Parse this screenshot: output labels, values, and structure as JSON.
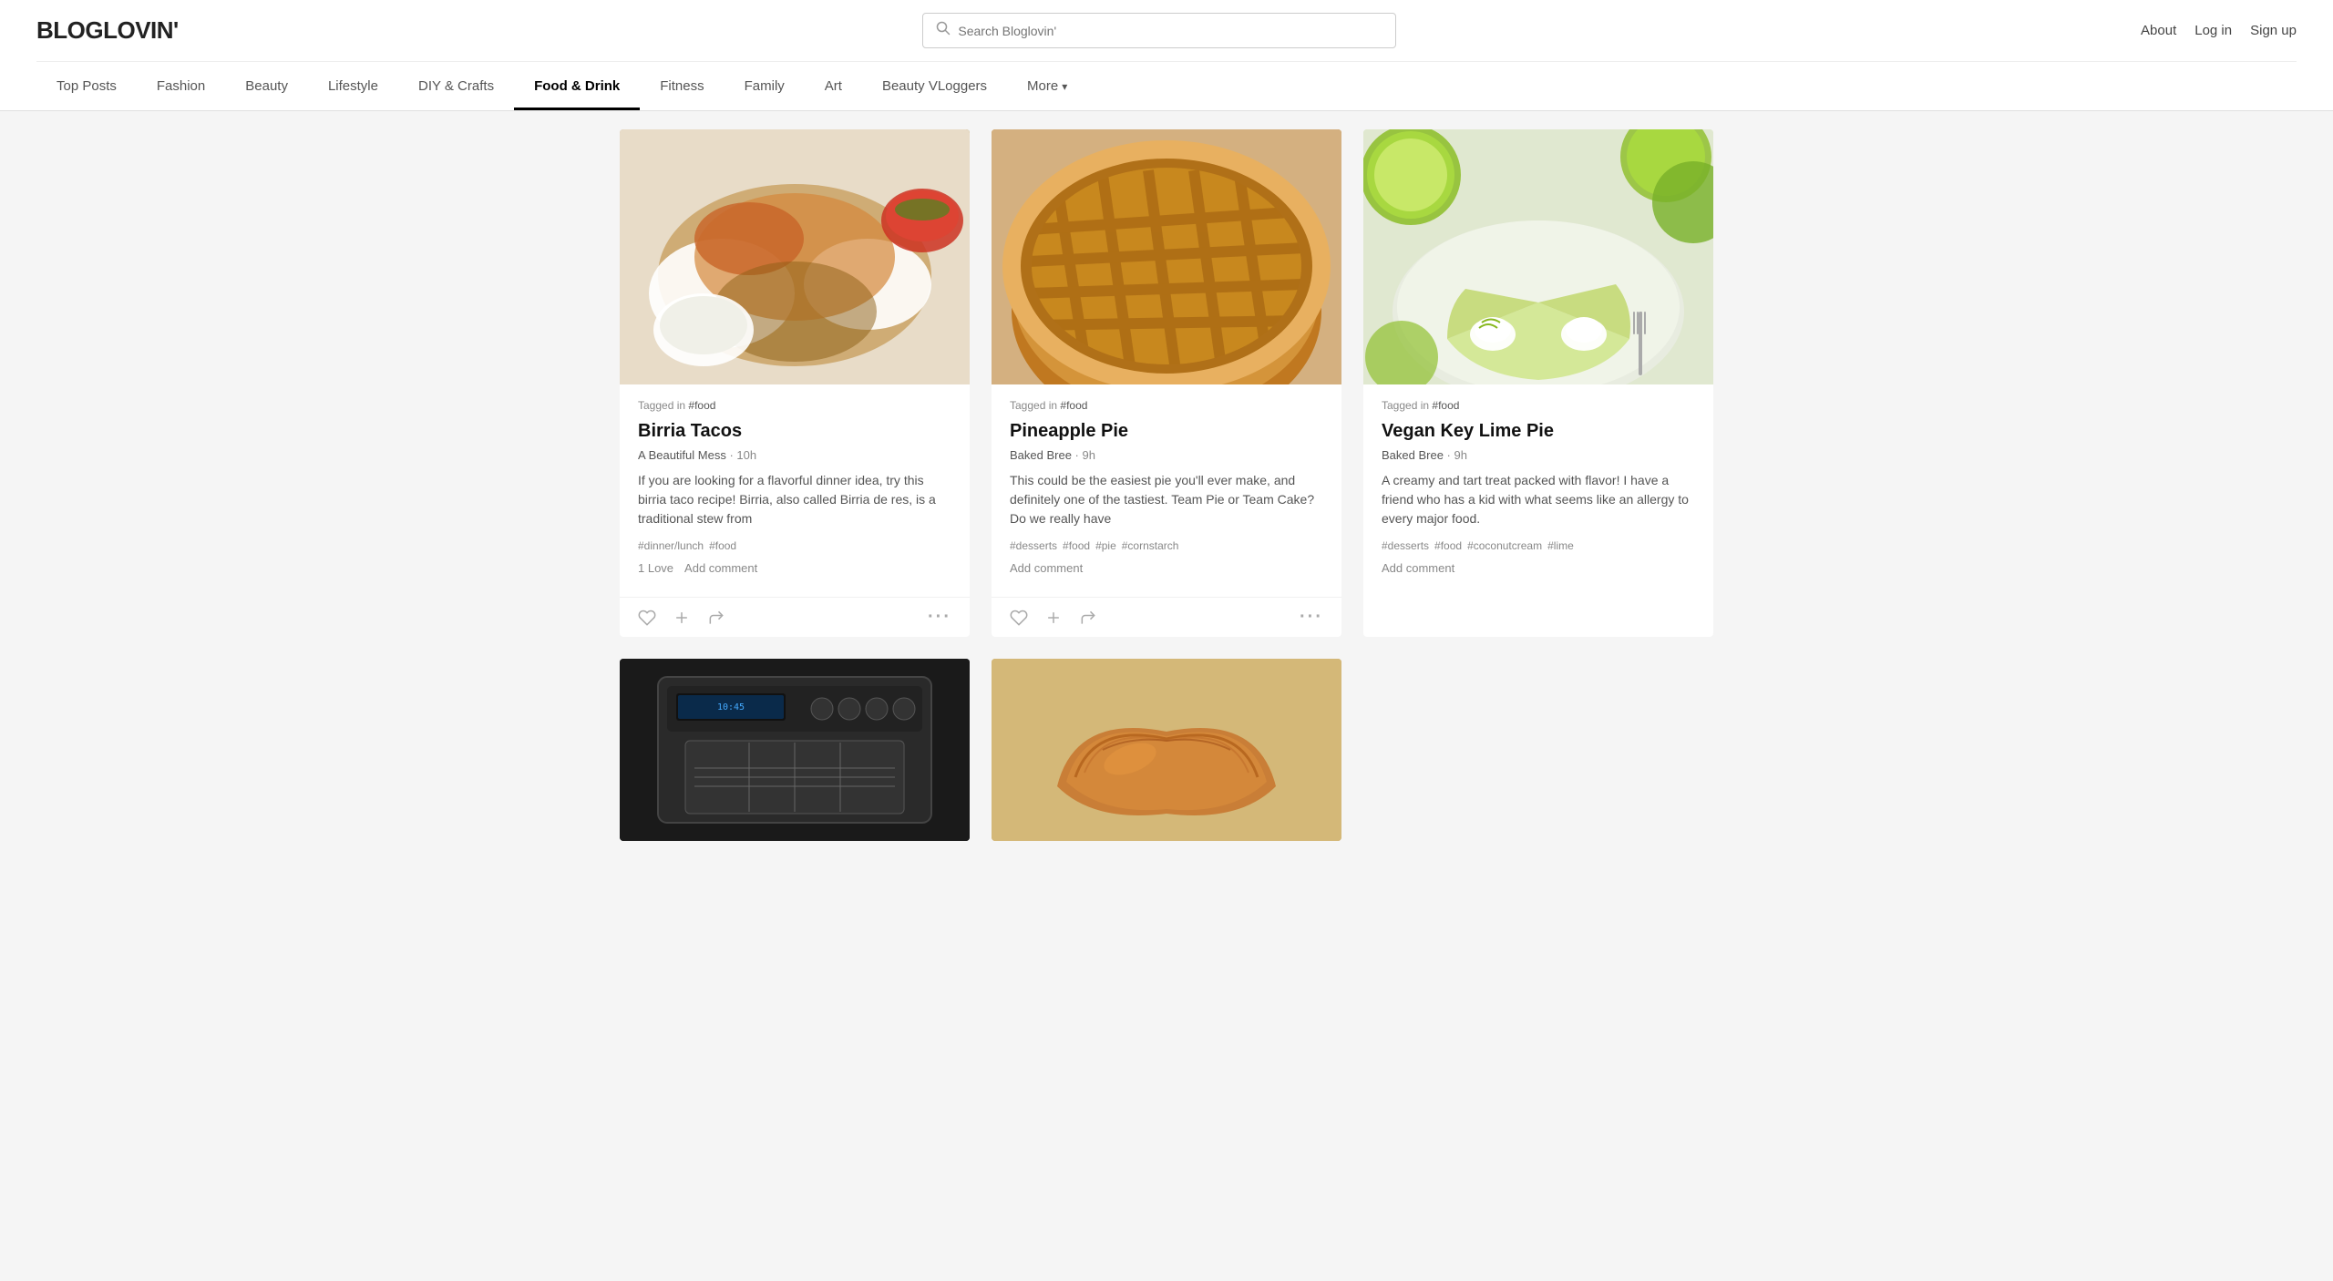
{
  "header": {
    "logo": "BLOGLOVIN'",
    "search": {
      "placeholder": "Search Bloglovin'",
      "value": ""
    },
    "links": [
      {
        "label": "About",
        "href": "#"
      },
      {
        "label": "Log in",
        "href": "#"
      },
      {
        "label": "Sign up",
        "href": "#"
      }
    ]
  },
  "nav": {
    "items": [
      {
        "label": "Top Posts",
        "active": false
      },
      {
        "label": "Fashion",
        "active": false
      },
      {
        "label": "Beauty",
        "active": false
      },
      {
        "label": "Lifestyle",
        "active": false
      },
      {
        "label": "DIY & Crafts",
        "active": false
      },
      {
        "label": "Food & Drink",
        "active": true
      },
      {
        "label": "Fitness",
        "active": false
      },
      {
        "label": "Family",
        "active": false
      },
      {
        "label": "Art",
        "active": false
      },
      {
        "label": "Beauty VLoggers",
        "active": false
      },
      {
        "label": "More",
        "active": false
      }
    ]
  },
  "posts": [
    {
      "id": "birria-tacos",
      "tagged": "#food",
      "title": "Birria Tacos",
      "source": "A Beautiful Mess",
      "time": "10h",
      "excerpt": "If you are looking for a flavorful dinner idea, try this birria taco recipe! Birria, also called Birria de res, is a traditional stew from",
      "tags": [
        "#dinner/lunch",
        "#food"
      ],
      "loves": "1 Love",
      "add_comment": "Add comment",
      "img_class": "img-tacos"
    },
    {
      "id": "pineapple-pie",
      "tagged": "#food",
      "title": "Pineapple Pie",
      "source": "Baked Bree",
      "time": "9h",
      "excerpt": "This could be the easiest pie you'll ever make, and definitely one of the tastiest. Team Pie or Team Cake? Do we really have",
      "tags": [
        "#desserts",
        "#food",
        "#pie",
        "#cornstarch"
      ],
      "loves": "",
      "add_comment": "Add comment",
      "img_class": "img-pie"
    },
    {
      "id": "vegan-key-lime-pie",
      "tagged": "#food",
      "title": "Vegan Key Lime Pie",
      "source": "Baked Bree",
      "time": "9h",
      "excerpt": "A creamy and tart treat packed with flavor! I have a friend who has a kid with what seems like an allergy to every major food.",
      "tags": [
        "#desserts",
        "#food",
        "#coconutcream",
        "#lime"
      ],
      "loves": "",
      "add_comment": "Add comment",
      "img_class": "img-lime-pie"
    }
  ],
  "bottom_posts": [
    {
      "id": "appliance",
      "img_class": "img-appliance"
    },
    {
      "id": "croissant",
      "img_class": "img-croissant"
    }
  ]
}
